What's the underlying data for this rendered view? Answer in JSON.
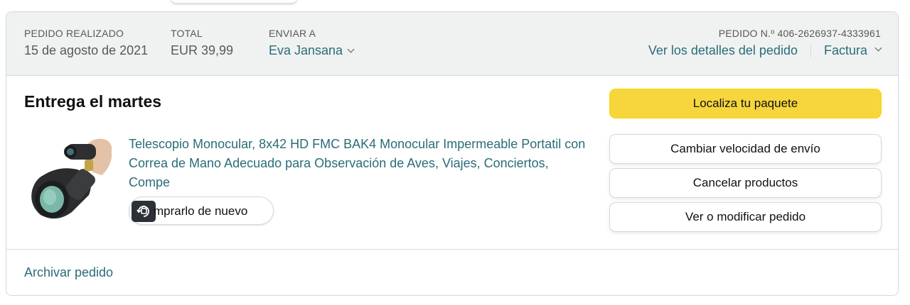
{
  "header": {
    "placed_label": "PEDIDO REALIZADO",
    "placed_value": "15 de agosto de 2021",
    "total_label": "TOTAL",
    "total_value": "EUR 39,99",
    "ship_label": "ENVIAR A",
    "ship_value": "Eva Jansana",
    "order_number": "PEDIDO N.º 406-2626937-4333961",
    "details_link": "Ver los detalles del pedido",
    "invoice_link": "Factura"
  },
  "shipment": {
    "title": "Entrega el martes",
    "product_name": "Telescopio Monocular, 8x42 HD FMC BAK4 Monocular Impermeable Portatil con Correa de Mano Adecuado para Observación de Aves, Viajes, Conciertos, Compe",
    "buy_again_label": "mprarlo de nuevo"
  },
  "actions": {
    "track": "Localiza tu paquete",
    "change_speed": "Cambiar velocidad de envío",
    "cancel": "Cancelar productos",
    "modify": "Ver o modificar pedido"
  },
  "footer": {
    "archive": "Archivar pedido"
  },
  "icons": {
    "chevron": "chevron-down-icon",
    "buy_again": "buy-again-icon",
    "product": "monocular-telescope-image"
  },
  "colors": {
    "link": "#2a6c78",
    "primary_button": "#f7d63d",
    "header_bg": "#f0f2f2"
  }
}
